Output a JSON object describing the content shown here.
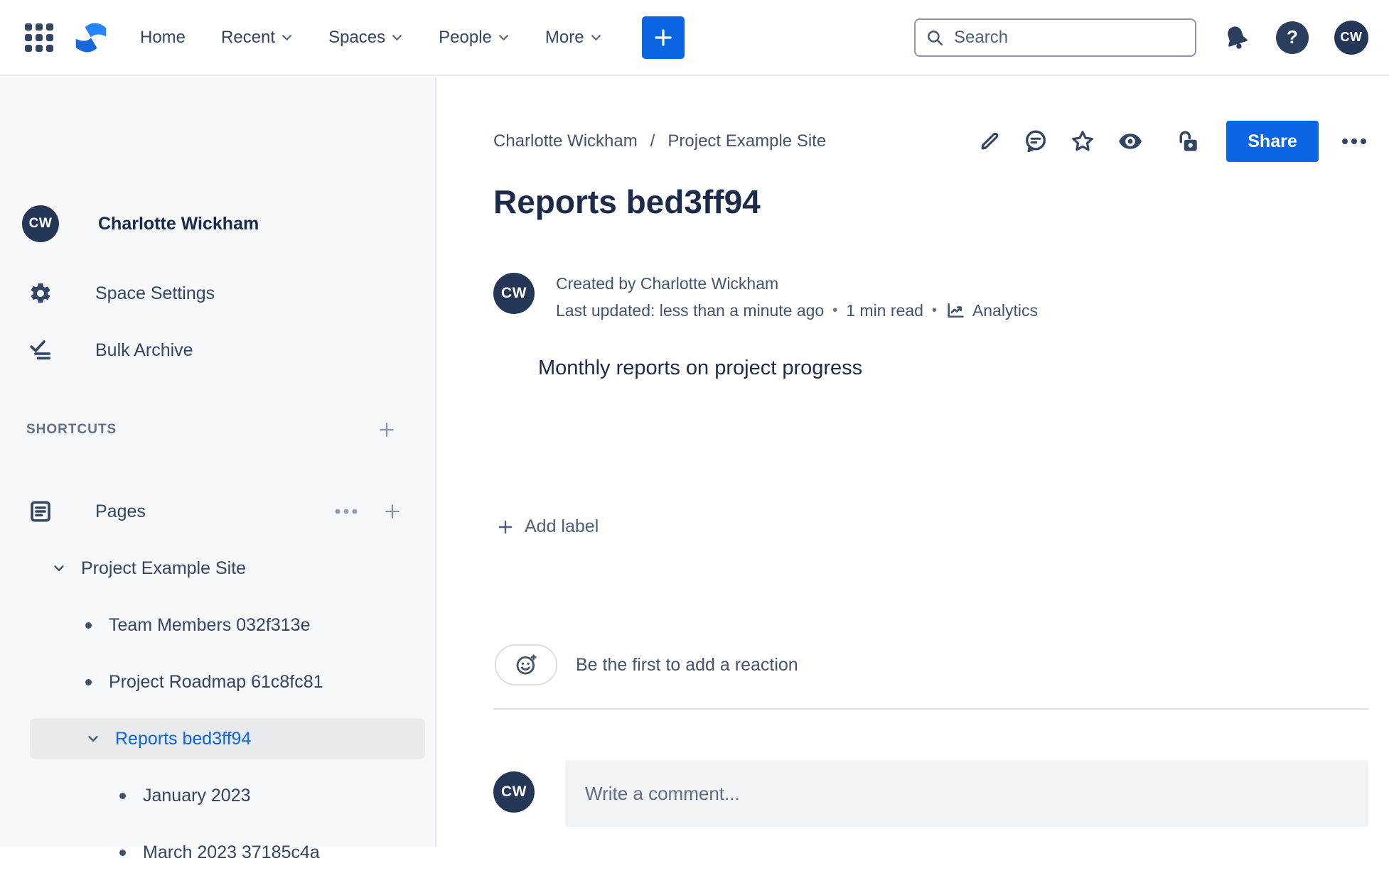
{
  "topbar": {
    "nav": [
      {
        "label": "Home",
        "chevron": false
      },
      {
        "label": "Recent",
        "chevron": true
      },
      {
        "label": "Spaces",
        "chevron": true
      },
      {
        "label": "People",
        "chevron": true
      },
      {
        "label": "More",
        "chevron": true
      }
    ],
    "search": {
      "placeholder": "Search"
    },
    "avatar_initials": "CW"
  },
  "sidebar": {
    "avatar_initials": "CW",
    "space_name": "Charlotte Wickham",
    "menu": [
      {
        "label": "Space Settings"
      },
      {
        "label": "Bulk Archive"
      }
    ],
    "shortcuts_label": "SHORTCUTS",
    "pages_label": "Pages",
    "tree": [
      {
        "label": "Project Example Site",
        "level": 0,
        "expanded": true
      },
      {
        "label": "Team Members 032f313e",
        "level": 1
      },
      {
        "label": "Project Roadmap 61c8fc81",
        "level": 1
      },
      {
        "label": "Reports bed3ff94",
        "level": 1,
        "expanded": true,
        "selected": true
      },
      {
        "label": "January 2023",
        "level": 2
      },
      {
        "label": "March 2023 37185c4a",
        "level": 2
      }
    ]
  },
  "content": {
    "breadcrumb": [
      "Charlotte Wickham",
      "Project Example Site"
    ],
    "breadcrumb_sep": "/",
    "share_label": "Share",
    "title": "Reports bed3ff94",
    "byline": {
      "avatar_initials": "CW",
      "created": "Created by Charlotte Wickham",
      "updated": "Last updated: less than a minute ago",
      "sep": "•",
      "read_time": "1 min read",
      "analytics_label": "Analytics"
    },
    "body_text": "Monthly reports on project progress",
    "add_label": "Add label",
    "reaction_hint": "Be the first to add a reaction",
    "comment": {
      "avatar_initials": "CW",
      "placeholder": "Write a comment..."
    }
  },
  "colors": {
    "accent_blue": "#0C66E4",
    "avatar_navy": "#243757",
    "selected_item_bg": "#E9EAEE",
    "selected_item_text": "#0C66E4",
    "sidebar_bg": "#F7F8F9",
    "text_primary": "#172B4D",
    "text_secondary": "#44546F"
  }
}
